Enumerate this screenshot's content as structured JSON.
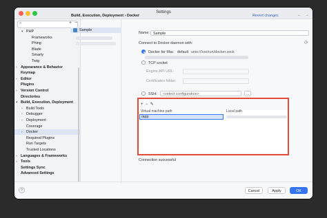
{
  "window": {
    "title": "Settings"
  },
  "sidebar": {
    "search_placeholder": "",
    "items": [
      {
        "label": "PHP",
        "indent": 1,
        "arrow": "▾",
        "bold": false
      },
      {
        "label": "Frameworks",
        "indent": 2,
        "arrow": "",
        "bold": false
      },
      {
        "label": "Phing",
        "indent": 2,
        "arrow": "",
        "bold": false
      },
      {
        "label": "Blade",
        "indent": 2,
        "arrow": "",
        "bold": false
      },
      {
        "label": "Smarty",
        "indent": 2,
        "arrow": "",
        "bold": false
      },
      {
        "label": "Twig",
        "indent": 2,
        "arrow": "",
        "bold": false
      },
      {
        "label": "Appearance & Behavior",
        "indent": 0,
        "arrow": "›",
        "bold": true
      },
      {
        "label": "Keymap",
        "indent": 0,
        "arrow": "",
        "bold": true
      },
      {
        "label": "Editor",
        "indent": 0,
        "arrow": "›",
        "bold": true
      },
      {
        "label": "Plugins",
        "indent": 0,
        "arrow": "",
        "bold": true
      },
      {
        "label": "Version Control",
        "indent": 0,
        "arrow": "›",
        "bold": true
      },
      {
        "label": "Directories",
        "indent": 0,
        "arrow": "",
        "bold": true
      },
      {
        "label": "Build, Execution, Deployment",
        "indent": 0,
        "arrow": "▾",
        "bold": true
      },
      {
        "label": "Build Tools",
        "indent": 1,
        "arrow": "›",
        "bold": false
      },
      {
        "label": "Debugger",
        "indent": 1,
        "arrow": "›",
        "bold": false
      },
      {
        "label": "Deployment",
        "indent": 1,
        "arrow": "›",
        "bold": false
      },
      {
        "label": "Coverage",
        "indent": 1,
        "arrow": "",
        "bold": false
      },
      {
        "label": "Docker",
        "indent": 1,
        "arrow": "›",
        "bold": false,
        "selected": true
      },
      {
        "label": "Required Plugins",
        "indent": 1,
        "arrow": "",
        "bold": false
      },
      {
        "label": "Run Targets",
        "indent": 1,
        "arrow": "",
        "bold": false
      },
      {
        "label": "Trusted Locations",
        "indent": 1,
        "arrow": "",
        "bold": false
      },
      {
        "label": "Languages & Frameworks",
        "indent": 0,
        "arrow": "›",
        "bold": true
      },
      {
        "label": "Tools",
        "indent": 0,
        "arrow": "›",
        "bold": true
      },
      {
        "label": "Settings Sync",
        "indent": 0,
        "arrow": "",
        "bold": true
      },
      {
        "label": "Advanced Settings",
        "indent": 0,
        "arrow": "",
        "bold": true
      }
    ]
  },
  "header": {
    "breadcrumb_parent": "Build, Execution, Deployment",
    "breadcrumb_sep": "›",
    "breadcrumb_current": "Docker",
    "revert": "Revert changes"
  },
  "mid": {
    "add": "+",
    "remove": "−",
    "item": "Sample"
  },
  "form": {
    "name_label": "Name:",
    "name_value": "Sample",
    "connect_label": "Connect to Docker daemon with:",
    "docker_mac": "Docker for Mac",
    "default_label": "default",
    "socket": "unix:///var/run/docker.sock",
    "tcp": "TCP socket",
    "engine_api": "Engine API URL:",
    "cert_folder": "Certificates folder:",
    "ssh": "SSH:",
    "ssh_select": "<select configuration>",
    "ssh_more": "..."
  },
  "mappings": {
    "add": "+",
    "remove": "−",
    "edit": "✎",
    "col_vm": "Virtual machine path",
    "col_local": "Local path",
    "row_vm": "/app"
  },
  "status": "Connection successful",
  "footer": {
    "help": "?",
    "cancel": "Cancel",
    "apply": "Apply",
    "ok": "OK"
  }
}
